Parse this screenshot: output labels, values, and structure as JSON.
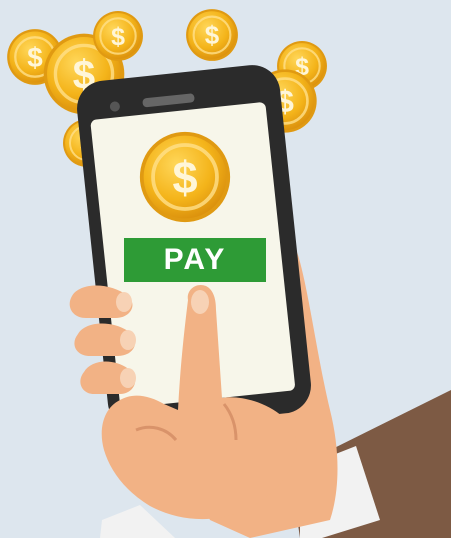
{
  "screen": {
    "pay_button_label": "PAY"
  },
  "icons": {
    "coin": "dollar-coin-icon",
    "phone": "smartphone-icon",
    "hand": "hand-icon"
  },
  "colors": {
    "background": "#dde6ee",
    "coin": "#f4b41a",
    "coin_dark": "#d98e0c",
    "pay_button": "#2e9b36",
    "pay_text": "#ffffff",
    "phone_body": "#2b2b2b",
    "screen": "#f7f6ea",
    "skin": "#f2b285",
    "sleeve_shirt": "#f2f2f2",
    "jacket": "#7d5a44"
  }
}
